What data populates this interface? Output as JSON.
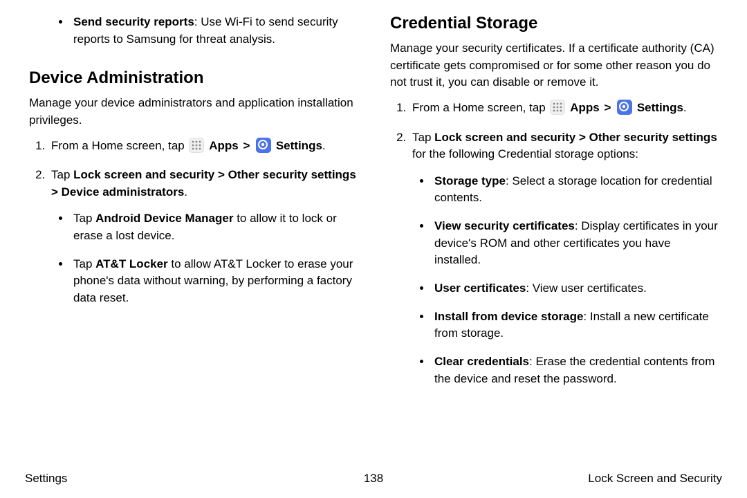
{
  "left": {
    "topBullet": {
      "bold": "Send security reports",
      "rest": ": Use Wi-Fi to send security reports to Samsung for threat analysis."
    },
    "h2": "Device Administration",
    "intro": "Manage your device administrators and application installation privileges.",
    "step1": {
      "pre": "From a Home screen, tap ",
      "apps": "Apps",
      "settings": "Settings",
      "post": "."
    },
    "step2": {
      "pre": "Tap ",
      "bold": "Lock screen and security > Other security settings > Device administrators",
      "post": "."
    },
    "sub1": {
      "pre": "Tap ",
      "bold": "Android Device Manager",
      "post": " to allow it to lock or erase a lost device."
    },
    "sub2": {
      "pre": "Tap ",
      "bold": "AT&T Locker",
      "post": " to allow AT&T Locker to erase your phone's data without warning, by performing a factory data reset."
    }
  },
  "right": {
    "h2": "Credential Storage",
    "intro": "Manage your security certificates. If a certificate authority (CA) certificate gets compromised or for some other reason you do not trust it, you can disable or remove it.",
    "step1": {
      "pre": "From a Home screen, tap ",
      "apps": "Apps",
      "settings": "Settings",
      "post": "."
    },
    "step2": {
      "pre": "Tap ",
      "bold": "Lock screen and security > Other security settings",
      "post": " for the following Credential storage options:"
    },
    "opts": [
      {
        "bold": "Storage type",
        "rest": ": Select a storage location for credential contents."
      },
      {
        "bold": "View security certificates",
        "rest": ": Display certificates in your device's ROM and other certificates you have installed."
      },
      {
        "bold": "User certificates",
        "rest": ": View user certificates."
      },
      {
        "bold": "Install from device storage",
        "rest": ": Install a new certificate from storage."
      },
      {
        "bold": "Clear credentials",
        "rest": ": Erase the credential contents from the device and reset the password."
      }
    ]
  },
  "footer": {
    "left": "Settings",
    "center": "138",
    "right": "Lock Screen and Security"
  }
}
